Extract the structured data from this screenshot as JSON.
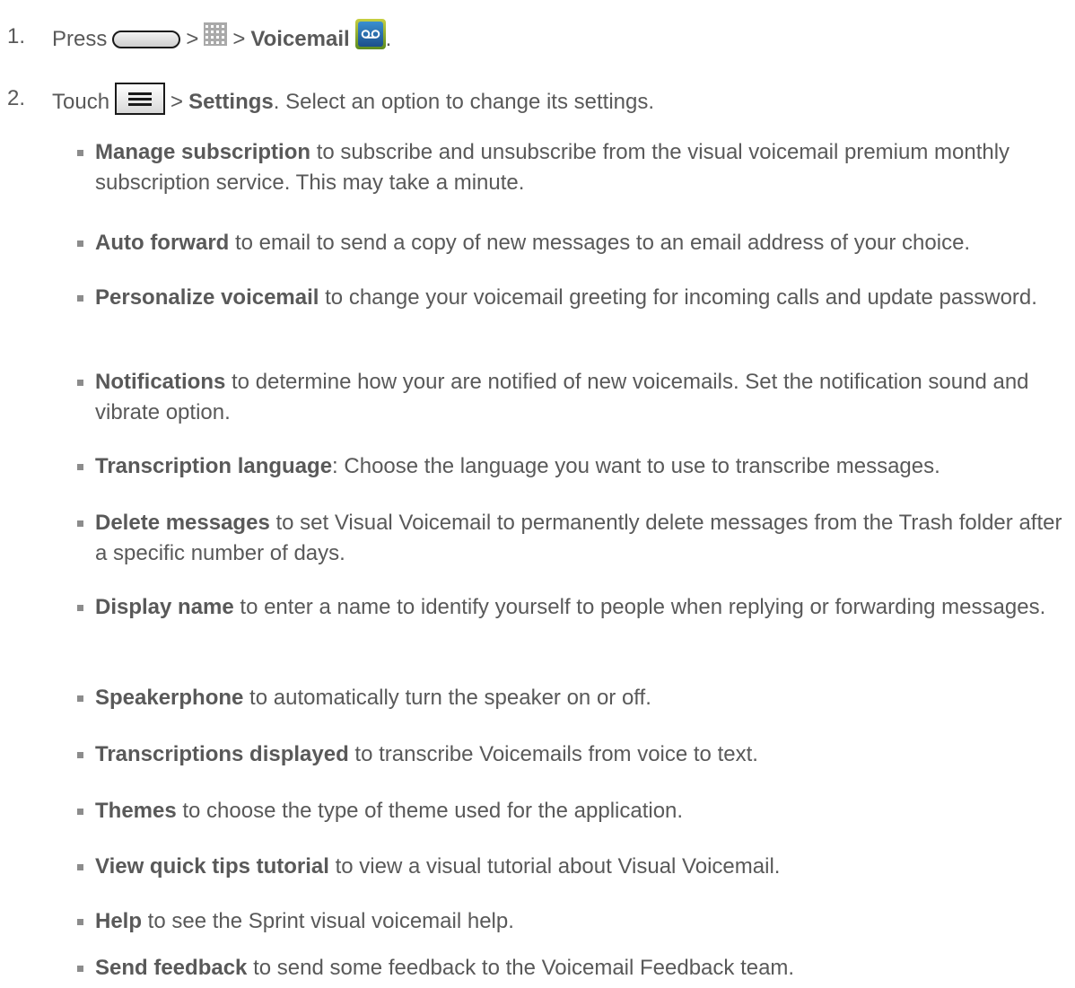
{
  "steps": [
    {
      "number": "1.",
      "press": "Press",
      "sep1": ">",
      "sep2": ">",
      "voicemail": "Voicemail",
      "end": "."
    },
    {
      "number": "2.",
      "touch": "Touch",
      "sep": ">",
      "settings": "Settings",
      "rest": ". Select an option to change its settings."
    }
  ],
  "icons": {
    "home_key": "home-key-icon",
    "apps": "apps-icon",
    "voicemail_app": "voicemail-app-icon",
    "menu_key": "menu-key-icon"
  },
  "options": [
    {
      "term": "Manage subscription",
      "desc": " to subscribe and unsubscribe from the visual voicemail premium monthly subscription service. This may take a minute."
    },
    {
      "term": "Auto forward",
      "desc": " to email to send a copy of new messages to an email address of your choice."
    },
    {
      "term": "Personalize voicemail",
      "desc": " to change your voicemail greeting for incoming calls and update password."
    },
    {
      "term": "Notifications",
      "desc": " to determine how your are notified of new voicemails. Set the notification sound and vibrate option."
    },
    {
      "term": "Transcription language",
      "desc": ": Choose the language you want to use to transcribe messages."
    },
    {
      "term": "Delete messages",
      "desc": " to set Visual Voicemail to permanently delete messages from the Trash folder after a specific number of days."
    },
    {
      "term": "Display name",
      "desc": " to enter a name to identify yourself to people when replying or forwarding messages."
    },
    {
      "term": "Speakerphone",
      "desc": " to automatically turn the speaker on or off."
    },
    {
      "term": "Transcriptions displayed",
      "desc": " to transcribe Voicemails from voice to text."
    },
    {
      "term": "Themes",
      "desc": " to choose the type of theme used for the application."
    },
    {
      "term": "View quick tips tutorial",
      "desc": " to view a visual tutorial about Visual Voicemail."
    },
    {
      "term": "Help",
      "desc": " to see the Sprint visual voicemail help."
    },
    {
      "term": "Send feedback",
      "desc": " to send some feedback to the Voicemail Feedback team."
    }
  ]
}
